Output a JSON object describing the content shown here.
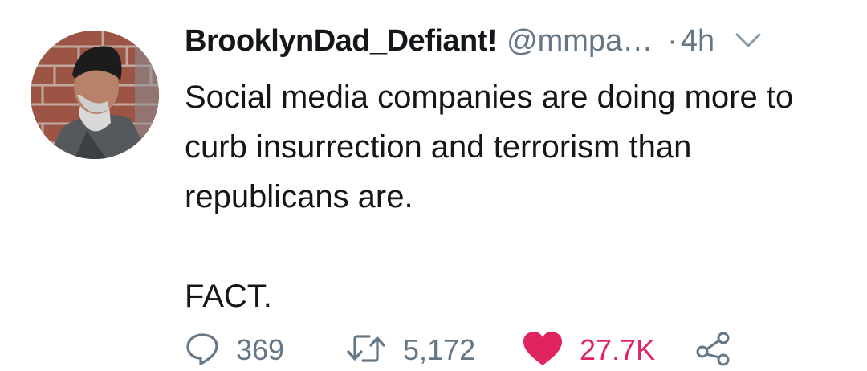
{
  "tweet": {
    "display_name": "BrooklynDad_Defiant!",
    "handle": "@mmpa…",
    "separator": "·",
    "time": "4h",
    "text": "Social media companies are doing more to curb insurrection and terrorism than republicans are.\n\nFACT.",
    "reply_count": "369",
    "retweet_count": "5,172",
    "like_count": "27.7K",
    "liked": true
  },
  "colors": {
    "text": "#14171a",
    "secondary": "#657786",
    "like": "#e0245e"
  },
  "icons": {
    "reply": "reply-icon",
    "retweet": "retweet-icon",
    "like": "heart-icon",
    "share": "share-icon",
    "menu": "chevron-down-icon"
  }
}
